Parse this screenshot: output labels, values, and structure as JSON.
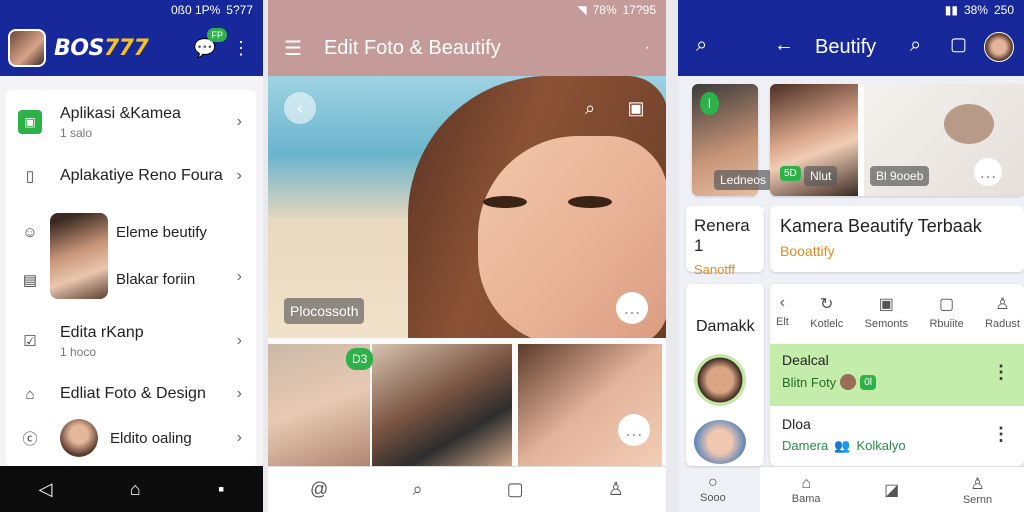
{
  "panel1": {
    "status": {
      "left": "0ß0 1P%",
      "time": "5?77"
    },
    "brand": {
      "a": "BOS",
      "b": "777"
    },
    "badge": "FP",
    "items": [
      {
        "title": "Aplikasi &Kamea",
        "sub": "1 salo"
      },
      {
        "title": "Aplakatiye Reno Foura",
        "sub": ""
      },
      {
        "title": "Eleme beutify",
        "sub": ""
      },
      {
        "title": "Blakar foriin",
        "sub": ""
      },
      {
        "title": "Edita rKanp",
        "sub": "1 hoco"
      },
      {
        "title": "Edliat Foto & Design",
        "sub": ""
      },
      {
        "title": "Eldito oaling",
        "sub": ""
      }
    ]
  },
  "panel2": {
    "status": {
      "pct": "78%",
      "time": "17?95"
    },
    "title": "Edit Foto & Beautify",
    "hero_label": "Plocossoth",
    "grid_badge": "D3"
  },
  "panel3": {
    "status": {
      "pct": "38%",
      "time": "250"
    },
    "title": "Beutify",
    "left_card_label": "Ledneos",
    "main_card": {
      "chip_green": "5D",
      "chip_left": "Nlut",
      "chip_right": "Bl 9ooeb"
    },
    "title_left": "Renera 1",
    "sub_left": "Sanotff",
    "title_main": "Kamera Beautify Terbaak",
    "sub_main": "Booattify",
    "side_heading": "Damakk",
    "tabs": [
      "Elt",
      "Kotlelc",
      "Semonts",
      "Rbuiite",
      "Radust"
    ],
    "rows": [
      {
        "title": "Dealcal",
        "sub": "Blitn Foty",
        "chip": "0l"
      },
      {
        "title": "Dloa",
        "sub": "Damera",
        "extra": "Kolkalyo"
      }
    ],
    "nav_left": "Sooo",
    "nav": [
      "Bama",
      "",
      "Sernn"
    ]
  },
  "colors": {
    "primary": "#17289a",
    "accent": "#f7c31b",
    "green": "#2fb14a",
    "rose": "#c49b98"
  }
}
